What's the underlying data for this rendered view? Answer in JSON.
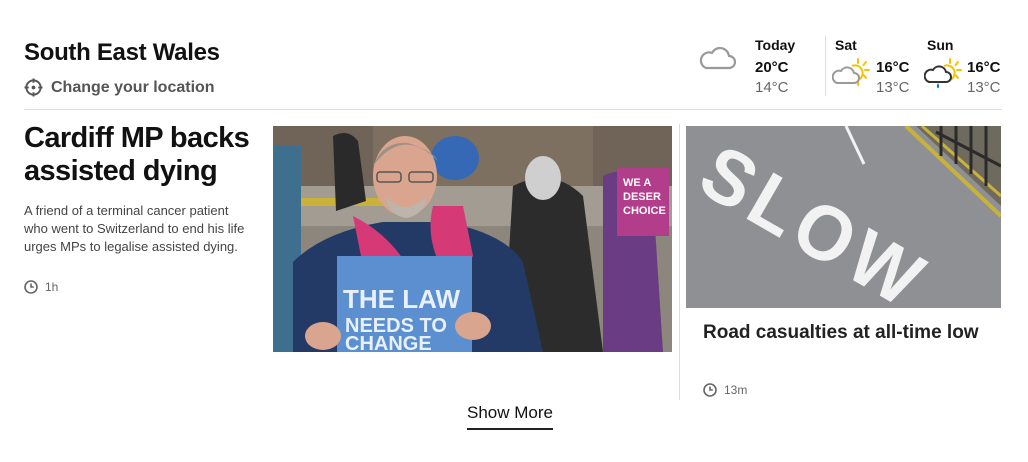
{
  "region": {
    "title": "South East Wales",
    "change_location": "Change your location"
  },
  "weather": {
    "days": [
      {
        "day": "Today",
        "high": "20°C",
        "low": "14°C",
        "icon": "cloud-icon"
      },
      {
        "day": "Sat",
        "high": "16°C",
        "low": "13°C",
        "icon": "sun-cloud-icon"
      },
      {
        "day": "Sun",
        "high": "16°C",
        "low": "13°C",
        "icon": "sun-rain-cloud-icon"
      }
    ]
  },
  "stories": {
    "lead": {
      "headline": "Cardiff MP backs assisted dying",
      "summary": "A friend of a terminal cancer patient who went to Switzerland to end his life urges MPs to legalise assisted dying.",
      "time": "1h",
      "image_sign_text": [
        "THE LAW",
        "NEEDS TO",
        "CHANGE"
      ],
      "image_bg_sign_text": [
        "WE A",
        "DESER",
        "CHOICE"
      ]
    },
    "second": {
      "headline": "Road casualties at all-time low",
      "time": "13m",
      "image_road_text": "SLOW"
    }
  },
  "show_more": "Show More",
  "colors": {
    "sun": "#f5c400",
    "cloud_outline": "#9a9a9a",
    "rain": "#1a75c9",
    "divider": "#dddddd"
  }
}
